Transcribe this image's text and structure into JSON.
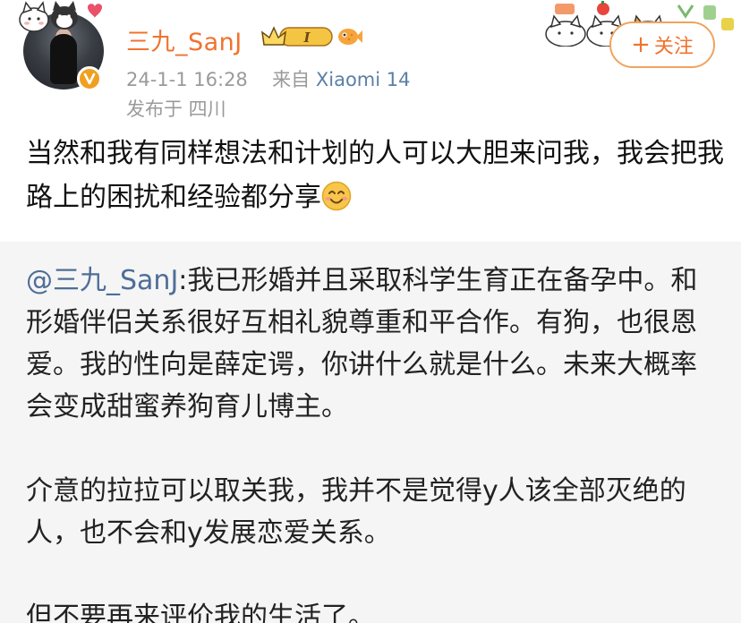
{
  "post": {
    "username": "三九_SanJ",
    "badge_level": "I",
    "timestamp": "24-1-1 16:28",
    "source_prefix": "来自",
    "source_device": "Xiaomi 14",
    "location": "发布于 四川",
    "follow_label": "关注",
    "follow_plus": "+",
    "text": "当然和我有同样想法和计划的人可以大胆来问我，我会把我路上的困扰和经验都分享"
  },
  "retweet": {
    "mention": "@三九_SanJ",
    "paragraph1": ":我已形婚并且采取科学生育正在备孕中。和形婚伴侣关系很好互相礼貌尊重和平合作。有狗，也很恩爱。我的性向是薛定谔，你讲什么就是什么。未来大概率会变成甜蜜养狗育儿博主。",
    "paragraph2": "介意的拉拉可以取关我，我并不是觉得y人该全部灭绝的人，也不会和y发展恋爱关系。",
    "paragraph3": "但不要再来评价我的生活了。"
  },
  "colors": {
    "username": "#f0732d",
    "link": "#4e6e97",
    "meta": "#9a9a9a",
    "retweet_bg": "#f5f5f5",
    "follow_border": "#f0a35f"
  },
  "icons": {
    "avatar_decoration": "cat-dog-sticker-icon",
    "verified": "verified-badge-icon",
    "crown": "crown-level-badge-icon",
    "fish": "fish-icon",
    "stickers": "cat-stickers-icon",
    "emoji": "smile-emoji-icon"
  }
}
